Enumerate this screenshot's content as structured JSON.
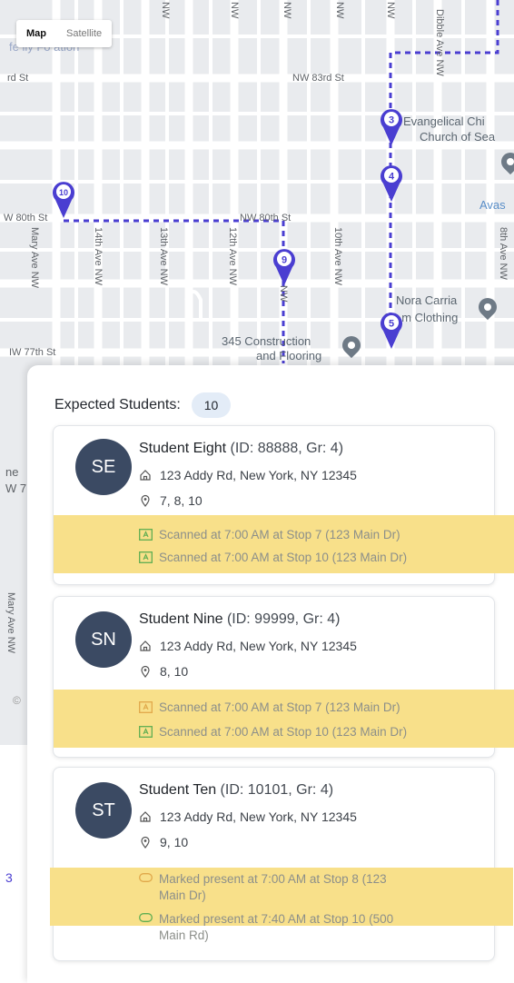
{
  "map": {
    "toggle": {
      "map_label": "Map",
      "satellite_label": "Satellite"
    },
    "streets": {
      "nw_83rd": "NW 83rd St",
      "rd_st": "rd St",
      "nw_80th_left": "W 80th St",
      "nw_80th_right": "NW 80th St",
      "nw_77th": "IW 77th St",
      "mary_ave": "Mary Ave NW",
      "ave_14th": "14th Ave NW",
      "ave_13th": "13th Ave NW",
      "ave_12th": "12th Ave NW",
      "ave_10th": "10th Ave NW",
      "dibble": "Dibble Ave NW",
      "ave_8th": "8th Ave NW",
      "nw_9th": "NW",
      "top_nw": "NW",
      "mary_ave_lower": "Mary Ave NW",
      "faded_top": "fe ily Fo ation",
      "left_ne": "ne",
      "left_w7": "W 7"
    },
    "pois": {
      "church_1": "Evangelical Chi",
      "church_2": "Church of Sea",
      "avas": "Avas",
      "nora_1": "Nora Carria",
      "nora_2": "Cu   m Clothing",
      "constr_1": "345 Construction",
      "constr_2": "and Flooring"
    },
    "stops": [
      "3",
      "4",
      "5",
      "9",
      "10"
    ],
    "colors": {
      "route": "#4a3ed1",
      "marker": "#4a3ed1"
    }
  },
  "panel": {
    "title": "Expected Students:",
    "count": "10",
    "students": [
      {
        "initials": "SE",
        "name": "Student Eight",
        "meta": " (ID: 88888, Gr: 4)",
        "address": "123 Addy Rd, New York, NY 12345",
        "stops": "7, 8, 10",
        "events": [
          "Scanned at 7:00 AM at Stop 7 (123 Main Dr)",
          "Scanned at 7:00 AM at Stop 10 (123 Main Dr)"
        ]
      },
      {
        "initials": "SN",
        "name": "Student Nine",
        "meta": " (ID: 99999, Gr: 4)",
        "address": "123 Addy Rd, New York, NY 12345",
        "stops": "8, 10",
        "events": [
          "Scanned at 7:00 AM at Stop 7 (123 Main Dr)",
          "Scanned at 7:00 AM at Stop 10 (123 Main Dr)"
        ]
      },
      {
        "initials": "ST",
        "name": "Student Ten",
        "meta": " (ID: 10101, Gr: 4)",
        "address": "123 Addy Rd, New York, NY 12345",
        "stops": "9, 10",
        "events": [
          "Marked present at 7:00 AM at Stop 8 (123",
          "Main Dr)",
          "Marked present at 7:40 AM at Stop 10 (500",
          "Main Rd)"
        ]
      }
    ],
    "left_edge_3": "3",
    "left_edge_c": "©"
  }
}
